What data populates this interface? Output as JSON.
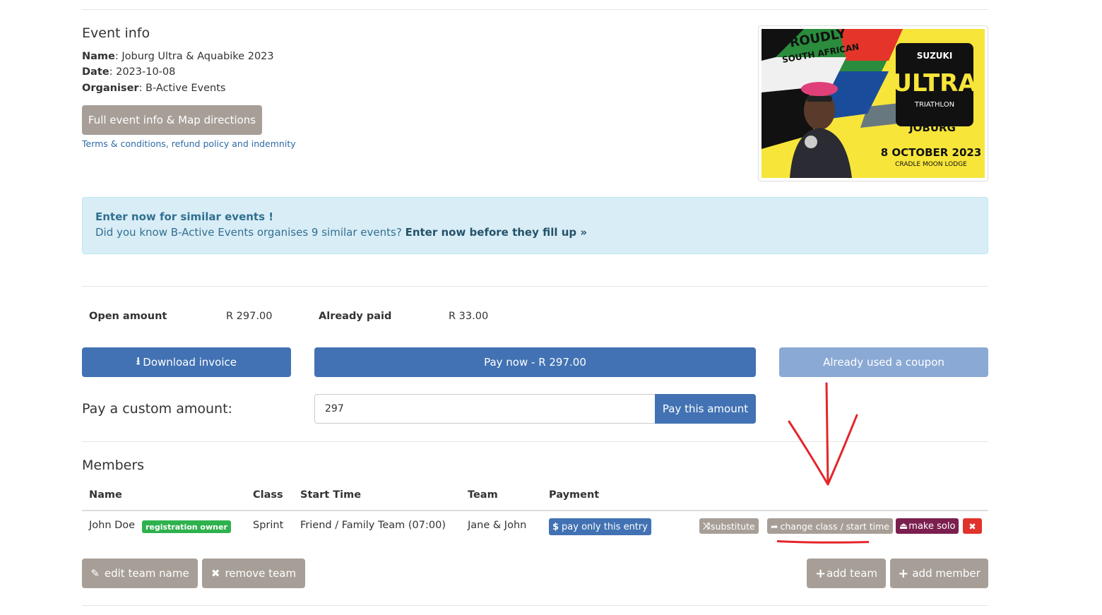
{
  "event_info": {
    "heading": "Event info",
    "name_label": "Name",
    "name_value": ": Joburg Ultra & Aquabike 2023",
    "date_label": "Date",
    "date_value": ": 2023-10-08",
    "organiser_label": "Organiser",
    "organiser_value": ": B-Active Events",
    "full_info_button": "Full event info & Map directions",
    "terms_link": "Terms & conditions, refund policy and indemnity"
  },
  "banner": {
    "line1": "PROUDLY",
    "line2": "SOUTH AFRICAN",
    "brand": "SUZUKI",
    "logo": "ULTRA",
    "sub": "TRIATHLON",
    "city": "JOBURG",
    "date": "8 OCTOBER 2023",
    "venue": "CRADLE MOON LODGE"
  },
  "alert": {
    "title": "Enter now for similar events !",
    "text": "Did you know B-Active Events organises 9 similar events? ",
    "link": "Enter now before they fill up »"
  },
  "payment": {
    "open_label": "Open amount",
    "open_value": "R 297.00",
    "paid_label": "Already paid",
    "paid_value": "R 33.00",
    "download_button": "Download invoice",
    "pay_now_button": "Pay now - R 297.00",
    "coupon_button": "Already used a coupon",
    "custom_label": "Pay a custom amount:",
    "custom_value": "297",
    "pay_amount_button": "Pay this amount"
  },
  "members": {
    "heading": "Members",
    "columns": [
      "Name",
      "Class",
      "Start Time",
      "Team",
      "Payment"
    ],
    "rows": [
      {
        "name": "John Doe",
        "badge": "registration owner",
        "class": "Sprint",
        "start_time": "Friend / Family Team (07:00)",
        "team": "Jane & John",
        "pay_entry": "pay only this entry",
        "substitute": "substitute",
        "change_class": "change class / start time",
        "make_solo": "make solo",
        "delete_glyph": "✖"
      }
    ],
    "edit_team_button": "edit team name",
    "remove_team_button": "remove team",
    "add_team_button": "add team",
    "add_member_button": "add member"
  },
  "colors": {
    "gray_button": "#a79f97",
    "blue_button": "#4272b3",
    "light_blue_button": "#8aa9d4",
    "green_badge": "#2fb14e",
    "purple_button": "#7b1f4f",
    "red_button": "#e0332c",
    "annotation_red": "#e4252a",
    "alert_bg": "#d9edf7"
  }
}
